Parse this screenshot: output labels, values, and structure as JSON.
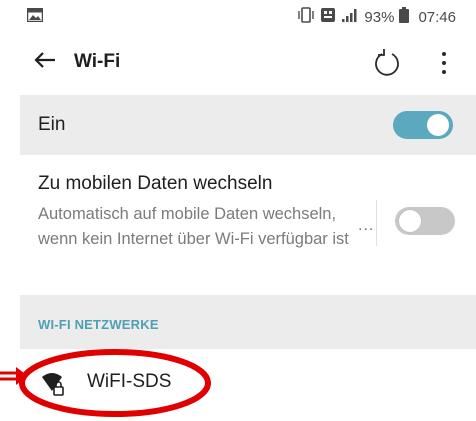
{
  "status_bar": {
    "gallery_icon": "image-icon",
    "vibrate_icon": "vibrate-icon",
    "network_icon": "lte-icon",
    "signal_icon": "signal-bars-icon",
    "battery_percent": "93%",
    "battery_icon": "battery-icon",
    "time": "07:46"
  },
  "appbar": {
    "back_icon": "arrow-left-icon",
    "title": "Wi-Fi",
    "refresh_icon": "refresh-icon",
    "more_icon": "more-vertical-icon"
  },
  "main_toggle": {
    "label": "Ein",
    "state": "on"
  },
  "mobile_data": {
    "title": "Zu mobilen Daten wechseln",
    "description": "Automatisch auf mobile Daten wechseln, wenn kein Internet über Wi-Fi verfügbar ist",
    "more_label": "...",
    "state": "off"
  },
  "section": {
    "title": "WI-FI NETZWERKE"
  },
  "networks": [
    {
      "name": "WiFI-SDS",
      "icon": "wifi-lock-icon",
      "secured": true
    }
  ],
  "colors": {
    "accent": "#5aa9be",
    "section_header": "#4e9fb5",
    "band_background": "#ececec",
    "annotation_red": "#e00000"
  }
}
